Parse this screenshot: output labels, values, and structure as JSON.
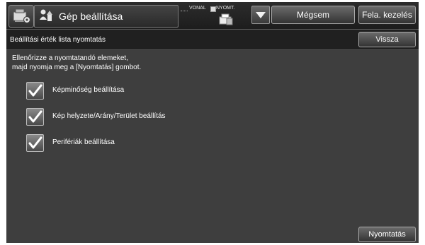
{
  "header": {
    "title": "Gép beállítása",
    "home_icon": "machine-settings-icon",
    "title_icon": "settings-person-icon"
  },
  "status": {
    "line_label": "VONAL",
    "print_label": "NYOMT.",
    "printer_icon": "printer-icon"
  },
  "toolbar": {
    "dropdown_icon": "triangle-down-icon",
    "cancel_label": "Mégsem",
    "release_label": "Fela. kezelés"
  },
  "subheader": {
    "title": "Beállítási érték lista nyomtatás",
    "back_label": "Vissza"
  },
  "instructions": {
    "line1": "Ellenőrizze a nyomtatandó elemeket,",
    "line2": "majd nyomja meg a [Nyomtatás] gombot."
  },
  "options": [
    {
      "label": "Képminőség beállítása",
      "checked": true
    },
    {
      "label": "Kép helyzete/Arány/Terület beállítás",
      "checked": true
    },
    {
      "label": "Perifériák beállítása",
      "checked": true
    }
  ],
  "actions": {
    "print_label": "Nyomtatás"
  },
  "colors": {
    "background": "#3e3e3e",
    "bar": "#202020",
    "button_border": "#a8a8a8",
    "text": "#ffffff"
  }
}
